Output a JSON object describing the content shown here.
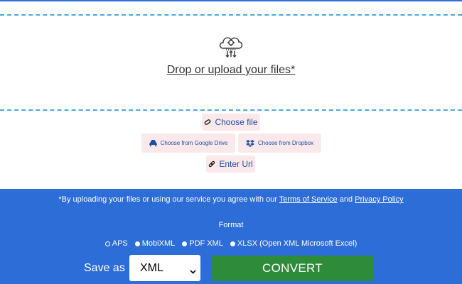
{
  "upload": {
    "drop_text": "Drop or upload your files*",
    "choose_file": "Choose file",
    "google_drive": "Choose from Google Drive",
    "dropbox": "Choose from Dropbox",
    "enter_url": "Enter Url"
  },
  "agreement": {
    "prefix": "*By uploading your files or using our service you agree with our",
    "terms": "Terms of Service",
    "and": "and",
    "privacy": "Privacy Policy"
  },
  "format": {
    "label": "Format",
    "options": [
      {
        "label": "APS",
        "selected": true
      },
      {
        "label": "MobiXML",
        "selected": false
      },
      {
        "label": "PDF XML",
        "selected": false
      },
      {
        "label": "XLSX (Open XML Microsoft Excel)",
        "selected": false
      }
    ]
  },
  "save": {
    "label": "Save as",
    "selected": "XML"
  },
  "convert_label": "CONVERT",
  "icons": {
    "upload": "cloud-gear-icon",
    "choose_file": "paperclip-icon",
    "google_drive": "google-drive-icon",
    "dropbox": "dropbox-icon",
    "enter_url": "link-icon",
    "select": "chevron-down-icon"
  },
  "colors": {
    "accent": "#2c6dd8",
    "convert": "#2e8b3a",
    "source_button": "#fbe8ea",
    "dashed_border": "#4aa9e0"
  }
}
